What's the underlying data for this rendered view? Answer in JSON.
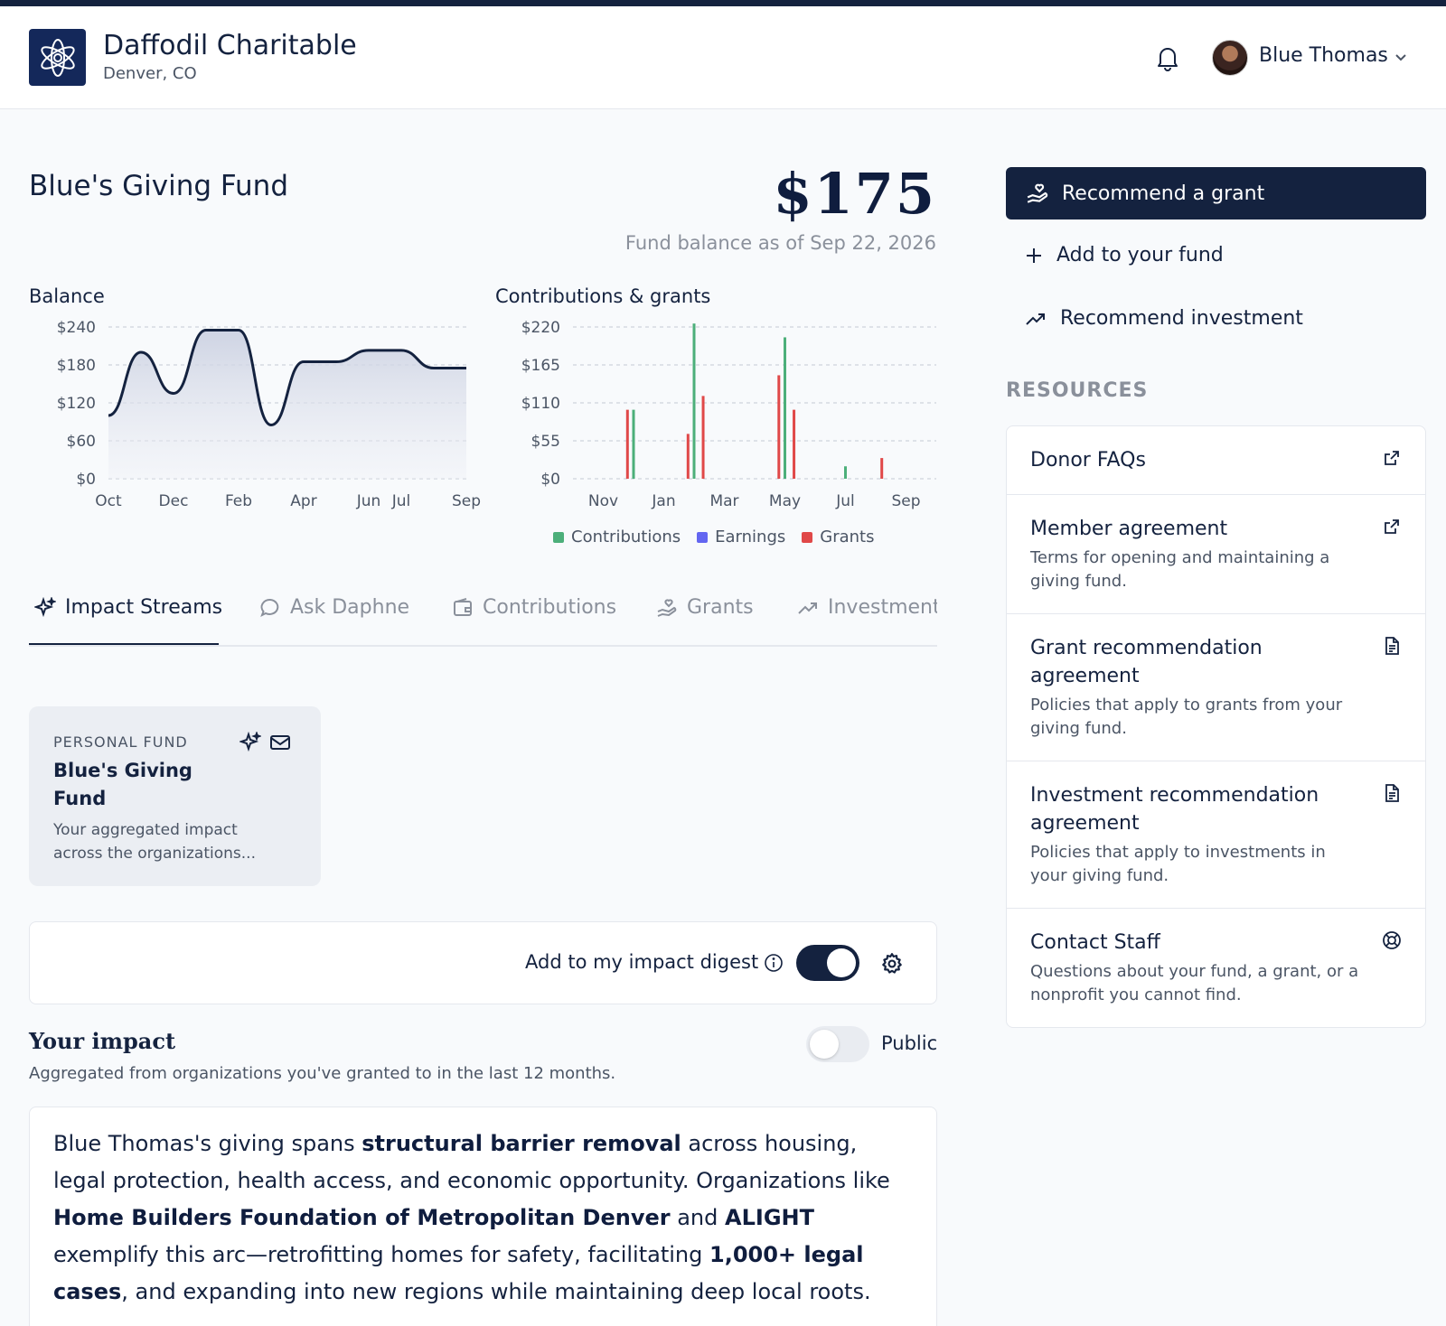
{
  "header": {
    "org_name": "Daffodil Charitable",
    "org_location": "Denver, CO",
    "user_name": "Blue Thomas"
  },
  "fund": {
    "title": "Blue's Giving Fund",
    "balance": "$175",
    "balance_caption": "Fund balance as of Sep 22, 2026"
  },
  "charts": {
    "balance_title": "Balance",
    "contrib_title": "Contributions & grants"
  },
  "chart_data": [
    {
      "type": "area",
      "title": "Balance",
      "x": [
        "Oct",
        "Nov",
        "Dec",
        "Jan",
        "Feb",
        "Mar",
        "Apr",
        "May",
        "Jun",
        "Jul",
        "Aug",
        "Sep"
      ],
      "x_tick_labels": [
        "Oct",
        "Dec",
        "Feb",
        "Apr",
        "Jun",
        "Jul",
        "Sep"
      ],
      "y_tick_labels": [
        "$240",
        "$180",
        "$120",
        "$60",
        "$0"
      ],
      "y_ticks": [
        240,
        180,
        120,
        60,
        0
      ],
      "series": [
        {
          "values": [
            100,
            200,
            135,
            235,
            235,
            85,
            185,
            185,
            203,
            203,
            175,
            175
          ]
        }
      ],
      "ylim": [
        0,
        240
      ],
      "grid": true
    },
    {
      "type": "bar",
      "title": "Contributions & grants",
      "x_tick_labels": [
        "Nov",
        "Jan",
        "Mar",
        "May",
        "Jul",
        "Sep"
      ],
      "y_tick_labels": [
        "$220",
        "$165",
        "$110",
        "$55",
        "$0"
      ],
      "y_ticks": [
        220,
        165,
        110,
        55,
        0
      ],
      "ylim": [
        0,
        220
      ],
      "legend": [
        "Contributions",
        "Earnings",
        "Grants"
      ],
      "colors": {
        "Contributions": "#4caf7a",
        "Earnings": "#6366f1",
        "Grants": "#e04848"
      },
      "series": [
        {
          "name": "Contributions",
          "points": [
            {
              "x": 10.0,
              "y": 100
            },
            {
              "x": 12.0,
              "y": 225
            },
            {
              "x": 15.0,
              "y": 205
            },
            {
              "x": 17.0,
              "y": 18
            }
          ]
        },
        {
          "name": "Earnings",
          "points": []
        },
        {
          "name": "Grants",
          "points": [
            {
              "x": 9.8,
              "y": 100
            },
            {
              "x": 11.8,
              "y": 65
            },
            {
              "x": 12.3,
              "y": 120
            },
            {
              "x": 14.8,
              "y": 150
            },
            {
              "x": 15.3,
              "y": 100
            },
            {
              "x": 18.2,
              "y": 30
            }
          ]
        }
      ],
      "legend_position": "bottom",
      "grid": true
    }
  ],
  "tabs": [
    {
      "label": "Impact Streams",
      "icon": "sparkles-icon"
    },
    {
      "label": "Ask Daphne",
      "icon": "chat-bubble-icon"
    },
    {
      "label": "Contributions",
      "icon": "wallet-icon"
    },
    {
      "label": "Grants",
      "icon": "hand-heart-icon"
    },
    {
      "label": "Investments",
      "icon": "trend-up-icon"
    }
  ],
  "fund_card": {
    "label": "PERSONAL FUND",
    "name": "Blue's Giving Fund",
    "desc": "Your aggregated impact across the organizations..."
  },
  "digest": {
    "label": "Add to my impact digest",
    "enabled": true
  },
  "impact": {
    "title": "Your impact",
    "subtitle": "Aggregated from organizations you've granted to in the last 12 months.",
    "public_label": "Public",
    "public_enabled": false,
    "text_parts": [
      {
        "t": "Blue Thomas's giving spans ",
        "b": false
      },
      {
        "t": "structural barrier removal",
        "b": true
      },
      {
        "t": " across housing, legal protection, health access, and economic opportunity. Organizations like ",
        "b": false
      },
      {
        "t": "Home Builders Foundation of Metropolitan Denver",
        "b": true
      },
      {
        "t": " and ",
        "b": false
      },
      {
        "t": "ALIGHT",
        "b": true
      },
      {
        "t": " exemplify this arc—retrofitting homes for safety, facilitating ",
        "b": false
      },
      {
        "t": "1,000+ legal cases",
        "b": true
      },
      {
        "t": ", and expanding into new regions while maintaining deep local roots.",
        "b": false
      }
    ]
  },
  "actions": {
    "recommend_grant": "Recommend a grant",
    "add_to_fund": "Add to your fund",
    "recommend_investment": "Recommend investment"
  },
  "resources": {
    "heading": "RESOURCES",
    "items": [
      {
        "title": "Donor FAQs",
        "desc": "",
        "icon": "external-link-icon"
      },
      {
        "title": "Member agreement",
        "desc": "Terms for opening and maintaining a giving fund.",
        "icon": "external-link-icon"
      },
      {
        "title": "Grant recommendation agreement",
        "desc": "Policies that apply to grants from your giving fund.",
        "icon": "document-icon"
      },
      {
        "title": "Investment recommendation agreement",
        "desc": "Policies that apply to investments in your giving fund.",
        "icon": "document-icon"
      },
      {
        "title": "Contact Staff",
        "desc": "Questions about your fund, a grant, or a nonprofit you cannot find.",
        "icon": "lifebuoy-icon"
      }
    ]
  }
}
